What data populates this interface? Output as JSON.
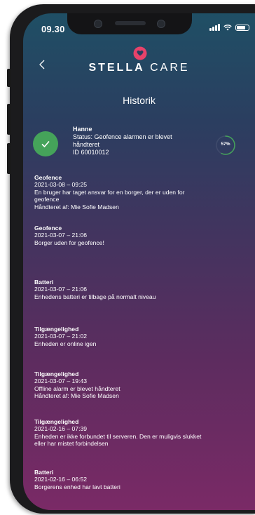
{
  "status_bar": {
    "time": "09.30"
  },
  "header": {
    "back_icon": "chevron-left-icon",
    "logo_icon": "stella-heart-logo-icon",
    "brand_bold": "STELLA",
    "brand_light": "CARE",
    "accent_color": "#e8426a"
  },
  "page": {
    "title": "Historik"
  },
  "status": {
    "name": "Hanne",
    "line1": "Status: Geofence alarmen er blevet",
    "line2": "håndteret",
    "id": "ID 60010012",
    "progress": "57%",
    "progress_value": 0.57,
    "check_color": "#45a35a"
  },
  "events": [
    {
      "title": "Geofence",
      "date": "2021-03-08 – 09:25",
      "lines": [
        "En bruger har taget ansvar for en borger, der er uden for",
        "geofence",
        "Håndteret af: Mie Sofie Madsen"
      ]
    },
    {
      "title": "Geofence",
      "date": "2021-03-07 – 21:06",
      "lines": [
        "Borger uden for geofence!"
      ]
    },
    {
      "title": "Batteri",
      "date": "2021-03-07 – 21:06",
      "lines": [
        "Enhedens batteri er tilbage på normalt niveau"
      ]
    },
    {
      "title": "Tilgængelighed",
      "date": "2021-03-07 – 21:02",
      "lines": [
        "Enheden er online igen"
      ]
    },
    {
      "title": "Tilgængelighed",
      "date": "2021-03-07 – 19:43",
      "lines": [
        "Offline alarm er blevet håndteret",
        "Håndteret af: Mie Sofie Madsen"
      ]
    },
    {
      "title": "Tilgængelighed",
      "date": "2021-02-16 – 07:39",
      "lines": [
        "Enheden er ikke forbundet til serveren. Den er muligvis slukket",
        "eller har mistet forbindelsen"
      ]
    },
    {
      "title": "Batteri",
      "date": "2021-02-16 – 06:52",
      "lines": [
        "Borgerens enhed har lavt batteri"
      ]
    }
  ]
}
